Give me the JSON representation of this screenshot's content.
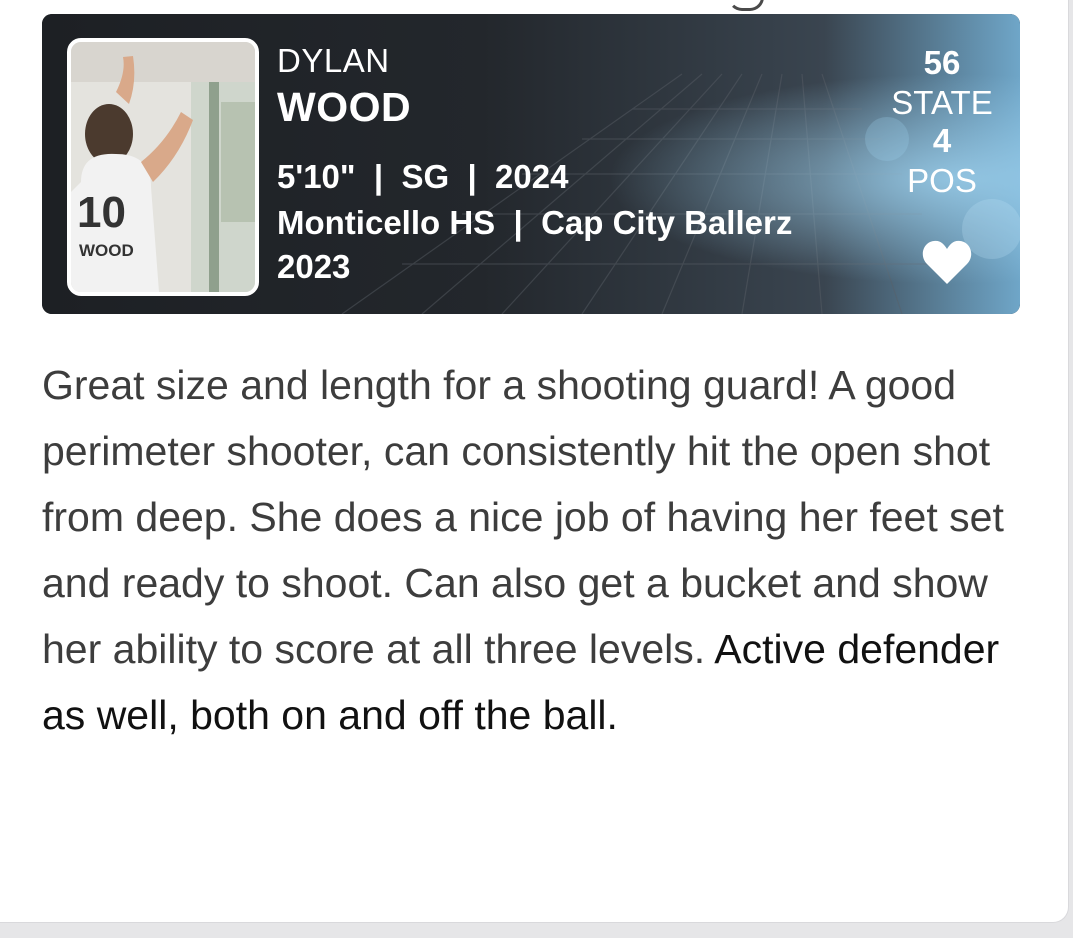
{
  "player": {
    "first_name": "DYLAN",
    "last_name": "WOOD",
    "info_line1": "5'10\"  |  SG  |  2024",
    "info_line2": "Monticello HS  |  Cap City Ballerz",
    "info_line3": "2023"
  },
  "rankings": {
    "state_rank": "56",
    "state_label": "STATE",
    "position_rank": "4",
    "position_label": "POS"
  },
  "photo": {
    "jersey_number": "10",
    "jersey_name": "WOOD"
  },
  "description": {
    "part1": "Great size and length for a shooting guard! A good perimeter shooter, can consistently hit the open shot from deep. She does a nice job of having her feet set and ready to shoot. Can also get a bucket and show her ability to score at all three levels.",
    "part2": "Active defender as well, both on and off the ball."
  },
  "icons": {
    "favorite": "heart-icon"
  },
  "colors": {
    "card_background": "#1f2226",
    "card_accent": "#5aa9d6",
    "text_primary": "#3d3d3d",
    "text_dark": "#111111"
  }
}
